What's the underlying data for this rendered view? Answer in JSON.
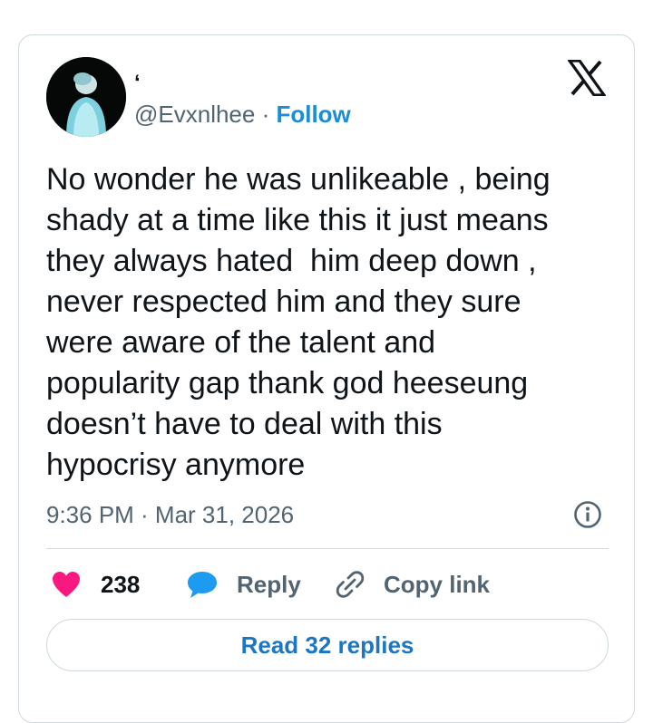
{
  "user": {
    "name": "‘",
    "handle": "@Evxnlhee",
    "separator": " · ",
    "follow_label": "Follow"
  },
  "icons": {
    "platform_logo": "x-logo-icon",
    "info": "info-icon",
    "like": "heart-icon",
    "reply": "speech-bubble-icon",
    "copy": "link-icon"
  },
  "tweet": {
    "text": "No wonder he was unlikeable , being\nshady at a time like this it just means\nthey always hated  him deep down ,\nnever respected him and they sure\nwere aware of the talent and\npopularity gap thank god heeseung\ndoesn’t have to deal with this\nhypocrisy anymore",
    "timestamp": "9:36 PM · Mar 31, 2026"
  },
  "actions": {
    "likes_count": "238",
    "reply_label": "Reply",
    "copy_label": "Copy link"
  },
  "read_replies_label": "Read 32 replies",
  "colors": {
    "heart": "#f91880",
    "reply_icon": "#1d9bf0",
    "link_blue": "#1d76c2",
    "border": "#cfd9de"
  }
}
